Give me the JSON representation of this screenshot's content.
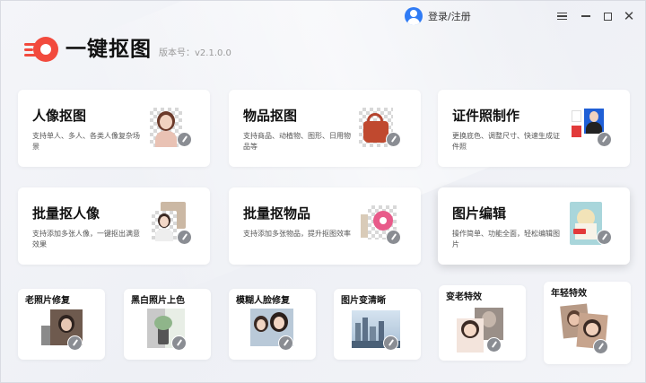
{
  "user": {
    "login_label": "登录/注册"
  },
  "logo": {
    "name": "一键抠图",
    "version": "版本号：v2.1.0.0"
  },
  "colors": {
    "brand": "#f24a3d",
    "accent": "#2f7bf5"
  },
  "icons": {
    "menu": "menu-icon",
    "minimize": "minimize-icon",
    "maximize": "maximize-icon",
    "close": "close-icon"
  },
  "window": {
    "close_glyph": "✕"
  },
  "cards": [
    {
      "title": "人像抠图",
      "desc": "支持单人、多人、各类人像复杂场景"
    },
    {
      "title": "物品抠图",
      "desc": "支持商品、动植物、图形、日用物品等"
    },
    {
      "title": "证件照制作",
      "desc": "更换底色、调整尺寸、快速生成证件照"
    },
    {
      "title": "批量抠人像",
      "desc": "支持添加多张人像，一键抠出满意效果"
    },
    {
      "title": "批量抠物品",
      "desc": "支持添加多张物品，提升抠图效率"
    },
    {
      "title": "图片编辑",
      "desc": "操作简单、功能全面，轻松编辑图片"
    }
  ],
  "tools": [
    {
      "title": "老照片修复"
    },
    {
      "title": "黑白照片上色"
    },
    {
      "title": "模糊人脸修复"
    },
    {
      "title": "图片变清晰"
    },
    {
      "title": "变老特效"
    },
    {
      "title": "年轻特效"
    }
  ]
}
